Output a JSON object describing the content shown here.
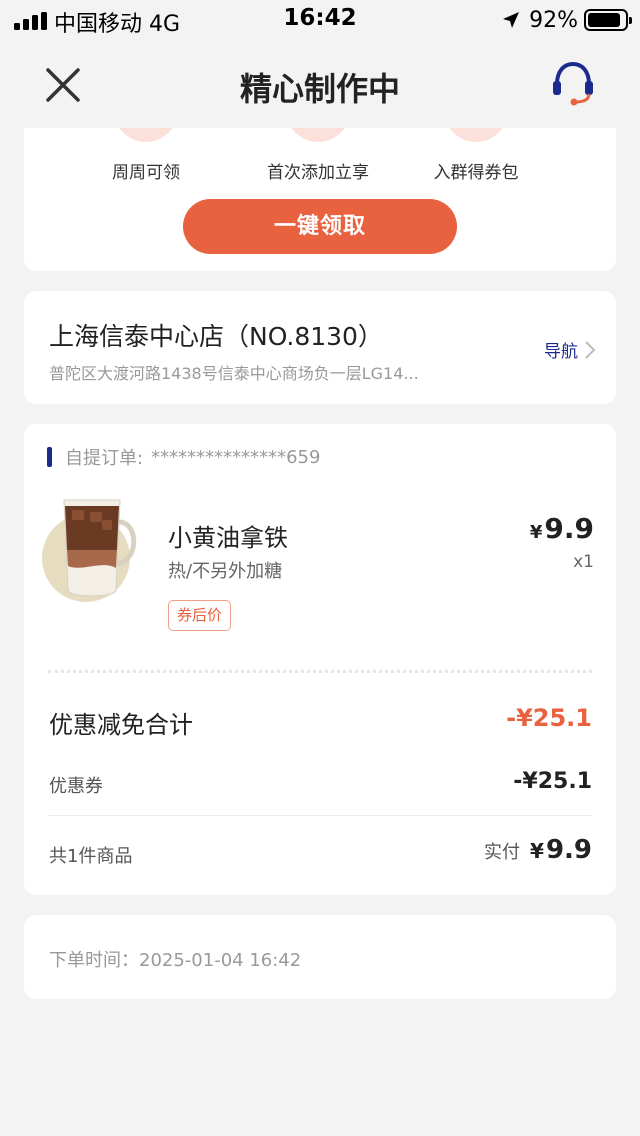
{
  "status_bar": {
    "carrier": "中国移动  4G",
    "time": "16:42",
    "battery": "92%"
  },
  "nav": {
    "title": "精心制作中",
    "close_icon": "close-icon",
    "service_icon": "headset-icon"
  },
  "benefits": {
    "items": [
      {
        "label": "周周可领"
      },
      {
        "label": "首次添加立享"
      },
      {
        "label": "入群得券包"
      }
    ],
    "claim_button": "一键领取"
  },
  "store": {
    "name": "上海信泰中心店（NO.8130）",
    "address": "普陀区大渡河路1438号信泰中心商场负一层LG14...",
    "navigate_label": "导航"
  },
  "order": {
    "type_label": "自提订单:",
    "order_number": "***************659",
    "product": {
      "name": "小黄油拿铁",
      "spec": "热/不另外加糖",
      "tag": "券后价",
      "price_symbol": "¥",
      "price": "9.9",
      "qty": "x1"
    },
    "discount_title": "优惠减免合计",
    "discount_total": "-¥25.1",
    "coupon_label": "优惠券",
    "coupon_value": "-¥25.1",
    "items_count": "共1件商品",
    "paid_label": "实付",
    "paid_symbol": "¥",
    "paid_value": "9.9"
  },
  "order_time": {
    "label": "下单时间：2025-01-04 16:42"
  },
  "colors": {
    "accent": "#e9623f",
    "brand_blue": "#1b2a8f",
    "background": "#f3f3f3"
  }
}
